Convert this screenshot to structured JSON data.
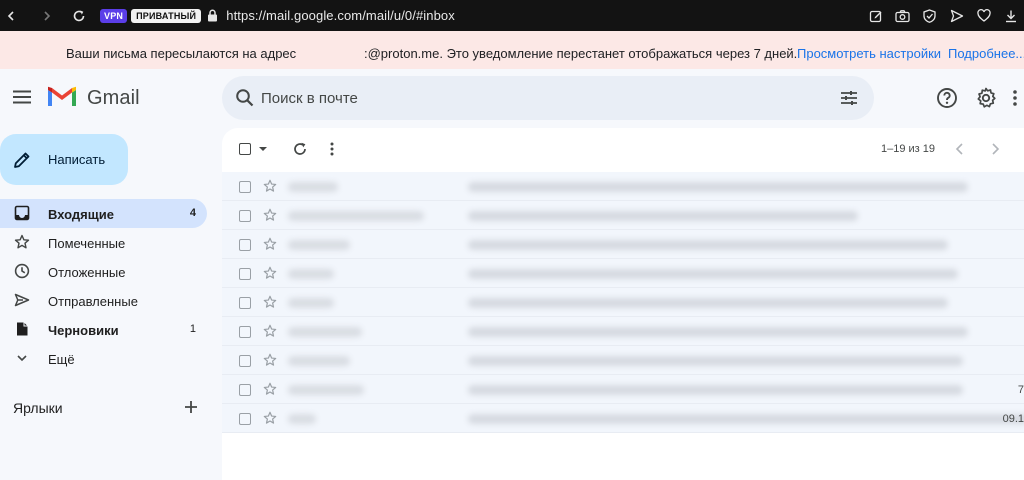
{
  "browser": {
    "vpn_badge": "VPN",
    "private_badge": "ПРИВАТНЫЙ",
    "url": "https://mail.google.com/mail/u/0/#inbox"
  },
  "banner": {
    "text_start": "Ваши письма пересылаются на адрес",
    "text_end": ":@proton.me. Это уведомление перестанет отображаться через 7 дней.",
    "link_settings": "Просмотреть настройки",
    "link_more": "Подробнее..."
  },
  "header": {
    "app_name": "Gmail",
    "search_placeholder": "Поиск в почте"
  },
  "compose": {
    "label": "Написать"
  },
  "sidebar": {
    "items": [
      {
        "label": "Входящие",
        "count": "4",
        "icon": "inbox-icon",
        "active": true,
        "bold": true
      },
      {
        "label": "Помеченные",
        "count": "",
        "icon": "star-icon",
        "active": false,
        "bold": false
      },
      {
        "label": "Отложенные",
        "count": "",
        "icon": "clock-icon",
        "active": false,
        "bold": false
      },
      {
        "label": "Отправленные",
        "count": "",
        "icon": "send-icon",
        "active": false,
        "bold": false
      },
      {
        "label": "Черновики",
        "count": "1",
        "icon": "draft-icon",
        "active": false,
        "bold": true
      },
      {
        "label": "Ещё",
        "count": "",
        "icon": "chevron-down-icon",
        "active": false,
        "bold": false
      }
    ],
    "labels_heading": "Ярлыки"
  },
  "toolbar": {
    "range": "1–19 из 19"
  },
  "mail": {
    "rows": [
      {
        "date": ""
      },
      {
        "date": ""
      },
      {
        "date": ""
      },
      {
        "date": ""
      },
      {
        "date": ""
      },
      {
        "date": ""
      },
      {
        "date": ""
      },
      {
        "date": "7"
      },
      {
        "date": "09.1"
      }
    ]
  },
  "colors": {
    "banner_bg": "#fce8e6",
    "link": "#1a73e8",
    "compose_bg": "#c2e7ff",
    "active_nav": "#d3e3fd",
    "search_bg": "#e9eef6",
    "app_bg": "#f6f8fc"
  }
}
